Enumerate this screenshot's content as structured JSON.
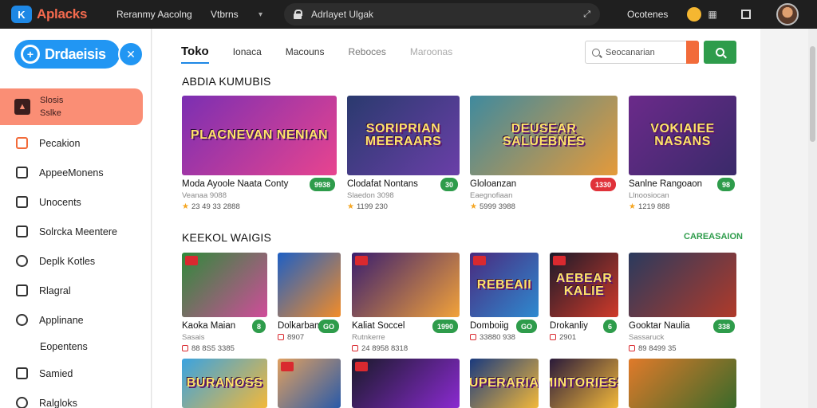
{
  "topbar": {
    "brand": "Aplacks",
    "brand_logo": "K",
    "links": [
      "Reranmy Aacolng",
      "Vtbrns"
    ],
    "address": "Adrlayet Ulgak",
    "right_link": "Ocotenes"
  },
  "sidebar": {
    "logo_word": "Drdaeisis",
    "active": {
      "line1": "Slosis",
      "line2": "Sslke"
    },
    "items": [
      {
        "label": "Pecakion",
        "icon": "orange-square-icon"
      },
      {
        "label": "AppeeMonens",
        "icon": "apps-icon"
      },
      {
        "label": "Unocents",
        "icon": "tag-icon"
      },
      {
        "label": "Solrcka Meentere",
        "icon": "document-icon"
      },
      {
        "label": "Deplk Kotles",
        "icon": "circle-icon"
      },
      {
        "label": "Rlagral",
        "icon": "pin-icon"
      },
      {
        "label": "Applinane",
        "icon": "people-icon"
      },
      {
        "label": "Eopentens",
        "icon": ""
      },
      {
        "label": "Samied",
        "icon": "inbox-icon"
      },
      {
        "label": "Ralgloks",
        "icon": "gear-icon"
      }
    ]
  },
  "main": {
    "tabs": [
      "Toko",
      "Ionaca",
      "Macouns",
      "Reboces",
      "Maroonas"
    ],
    "search_placeholder": "Seocanarian",
    "section1": {
      "title": "ABDIA KUMUBIS"
    },
    "section2": {
      "title": "KEEKOL WAIGIS",
      "link": "CAREASAION"
    },
    "row1": [
      {
        "art": "PLACNEVAN NENIAN",
        "title": "Moda Ayoole Naata Conty",
        "sub": "Veanaa 9088",
        "meta": "23 49 33 2888",
        "price": "9938",
        "badge": "green",
        "bg": "#7b2fb2",
        "bg2": "#e8448f"
      },
      {
        "art": "SORIPRIAN MEERAARS",
        "title": "Clodafat Nontans",
        "sub": "Slaedon 3098",
        "meta": "1199 230",
        "price": "30",
        "badge": "green",
        "bg": "#2a3a6e",
        "bg2": "#6a3fa8"
      },
      {
        "art": "DEUSEAR SALUEBNES",
        "title": "Gloloanzan",
        "sub": "Eaegnofiaan",
        "meta": "5999 3988",
        "price": "1330",
        "badge": "red",
        "bg": "#3f8a9e",
        "bg2": "#e59a3a"
      },
      {
        "art": "VOKIAIEE NASANS",
        "title": "Sanlne Rangoaon",
        "sub": "Llnoosiocan",
        "meta": "1219 888",
        "price": "98",
        "badge": "green",
        "bg": "#6b2a8a",
        "bg2": "#3a2a6a"
      }
    ],
    "row2": [
      {
        "art": "",
        "title": "Kaoka Maian",
        "sub": "Sasais",
        "meta": "88 8S5 3385",
        "price": "8",
        "badge": "green",
        "bg": "#2f8a3a",
        "bg2": "#d04c9a",
        "tag": true
      },
      {
        "art": "",
        "title": "Dolkarban",
        "sub": "",
        "meta": "8907",
        "price": "GO",
        "badge": "green",
        "bg": "#1e5fc4",
        "bg2": "#f28c28"
      },
      {
        "art": "",
        "title": "Kaliat Soccel",
        "sub": "Rutnkerre",
        "meta": "24 8958 8318",
        "price": "1990",
        "badge": "green",
        "bg": "#3a1e6e",
        "bg2": "#f2a23a",
        "tag": true
      },
      {
        "art": "REBEAII",
        "title": "Domboiig",
        "sub": "",
        "meta": "33880 938",
        "price": "GO",
        "badge": "green",
        "bg": "#4a2a7e",
        "bg2": "#2e8ad0",
        "tag": true
      },
      {
        "art": "AEBEAR KALIE",
        "title": "Drokanliy",
        "sub": "",
        "meta": "2901",
        "price": "6",
        "badge": "green",
        "bg": "#1a1a2a",
        "bg2": "#d03a2a",
        "tag": true
      },
      {
        "art": "",
        "title": "Gooktar Naulia",
        "sub": "Sassaruck",
        "meta": "89 8499 35",
        "price": "338",
        "badge": "green",
        "bg": "#2a3a5e",
        "bg2": "#b03a2a"
      }
    ],
    "row3": [
      {
        "art": "BURANOSS",
        "bg": "#3aa3e0",
        "bg2": "#f2b83a"
      },
      {
        "art": "",
        "bg": "#e0a060",
        "bg2": "#2a5aa8",
        "tag": true
      },
      {
        "art": "",
        "bg": "#1a1a2a",
        "bg2": "#8a2ad0",
        "tag": true
      },
      {
        "art": "SUPERARIAN",
        "bg": "#1a3a7e",
        "bg2": "#f2b83a"
      },
      {
        "art": "MINTORIESS",
        "bg": "#2a1a3a",
        "bg2": "#f2b83a"
      },
      {
        "art": "",
        "bg": "#e07a2a",
        "bg2": "#3a6a2a"
      }
    ]
  },
  "colors": {
    "accent": "#1e88e5",
    "brand": "#f46a4e",
    "active_bg": "#fa8e75",
    "success": "#2e9c4b",
    "danger": "#e0323a"
  }
}
